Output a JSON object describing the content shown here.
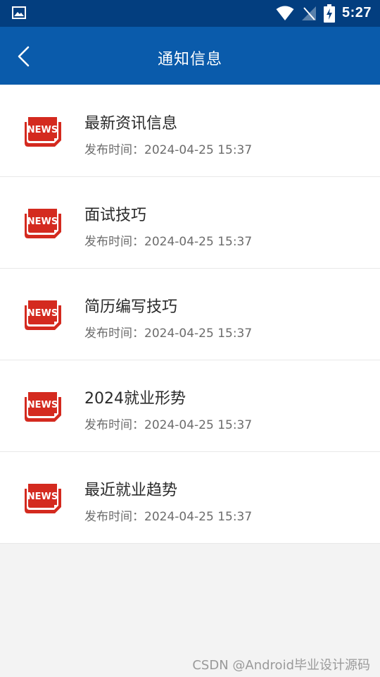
{
  "status_bar": {
    "time": "5:27",
    "icons": [
      "image-icon",
      "wifi-icon",
      "no-signal-icon",
      "battery-charging-icon"
    ]
  },
  "app_bar": {
    "title": "通知信息",
    "back_icon": "chevron-left-icon",
    "background": "#0a5bab"
  },
  "notices": [
    {
      "title": "最新资讯信息",
      "time_label": "发布时间：2024-04-25 15:37",
      "icon": "news-icon"
    },
    {
      "title": "面试技巧",
      "time_label": "发布时间：2024-04-25 15:37",
      "icon": "news-icon"
    },
    {
      "title": "简历编写技巧",
      "time_label": "发布时间：2024-04-25 15:37",
      "icon": "news-icon"
    },
    {
      "title": "2024就业形势",
      "time_label": "发布时间：2024-04-25 15:37",
      "icon": "news-icon"
    },
    {
      "title": "最近就业趋势",
      "time_label": "发布时间：2024-04-25 15:37",
      "icon": "news-icon"
    }
  ],
  "news_icon_text": "NEWS",
  "colors": {
    "status_bar": "#033e7f",
    "accent": "#0a5bab",
    "news_red": "#d42a1f"
  },
  "watermark": "CSDN @Android毕业设计源码"
}
